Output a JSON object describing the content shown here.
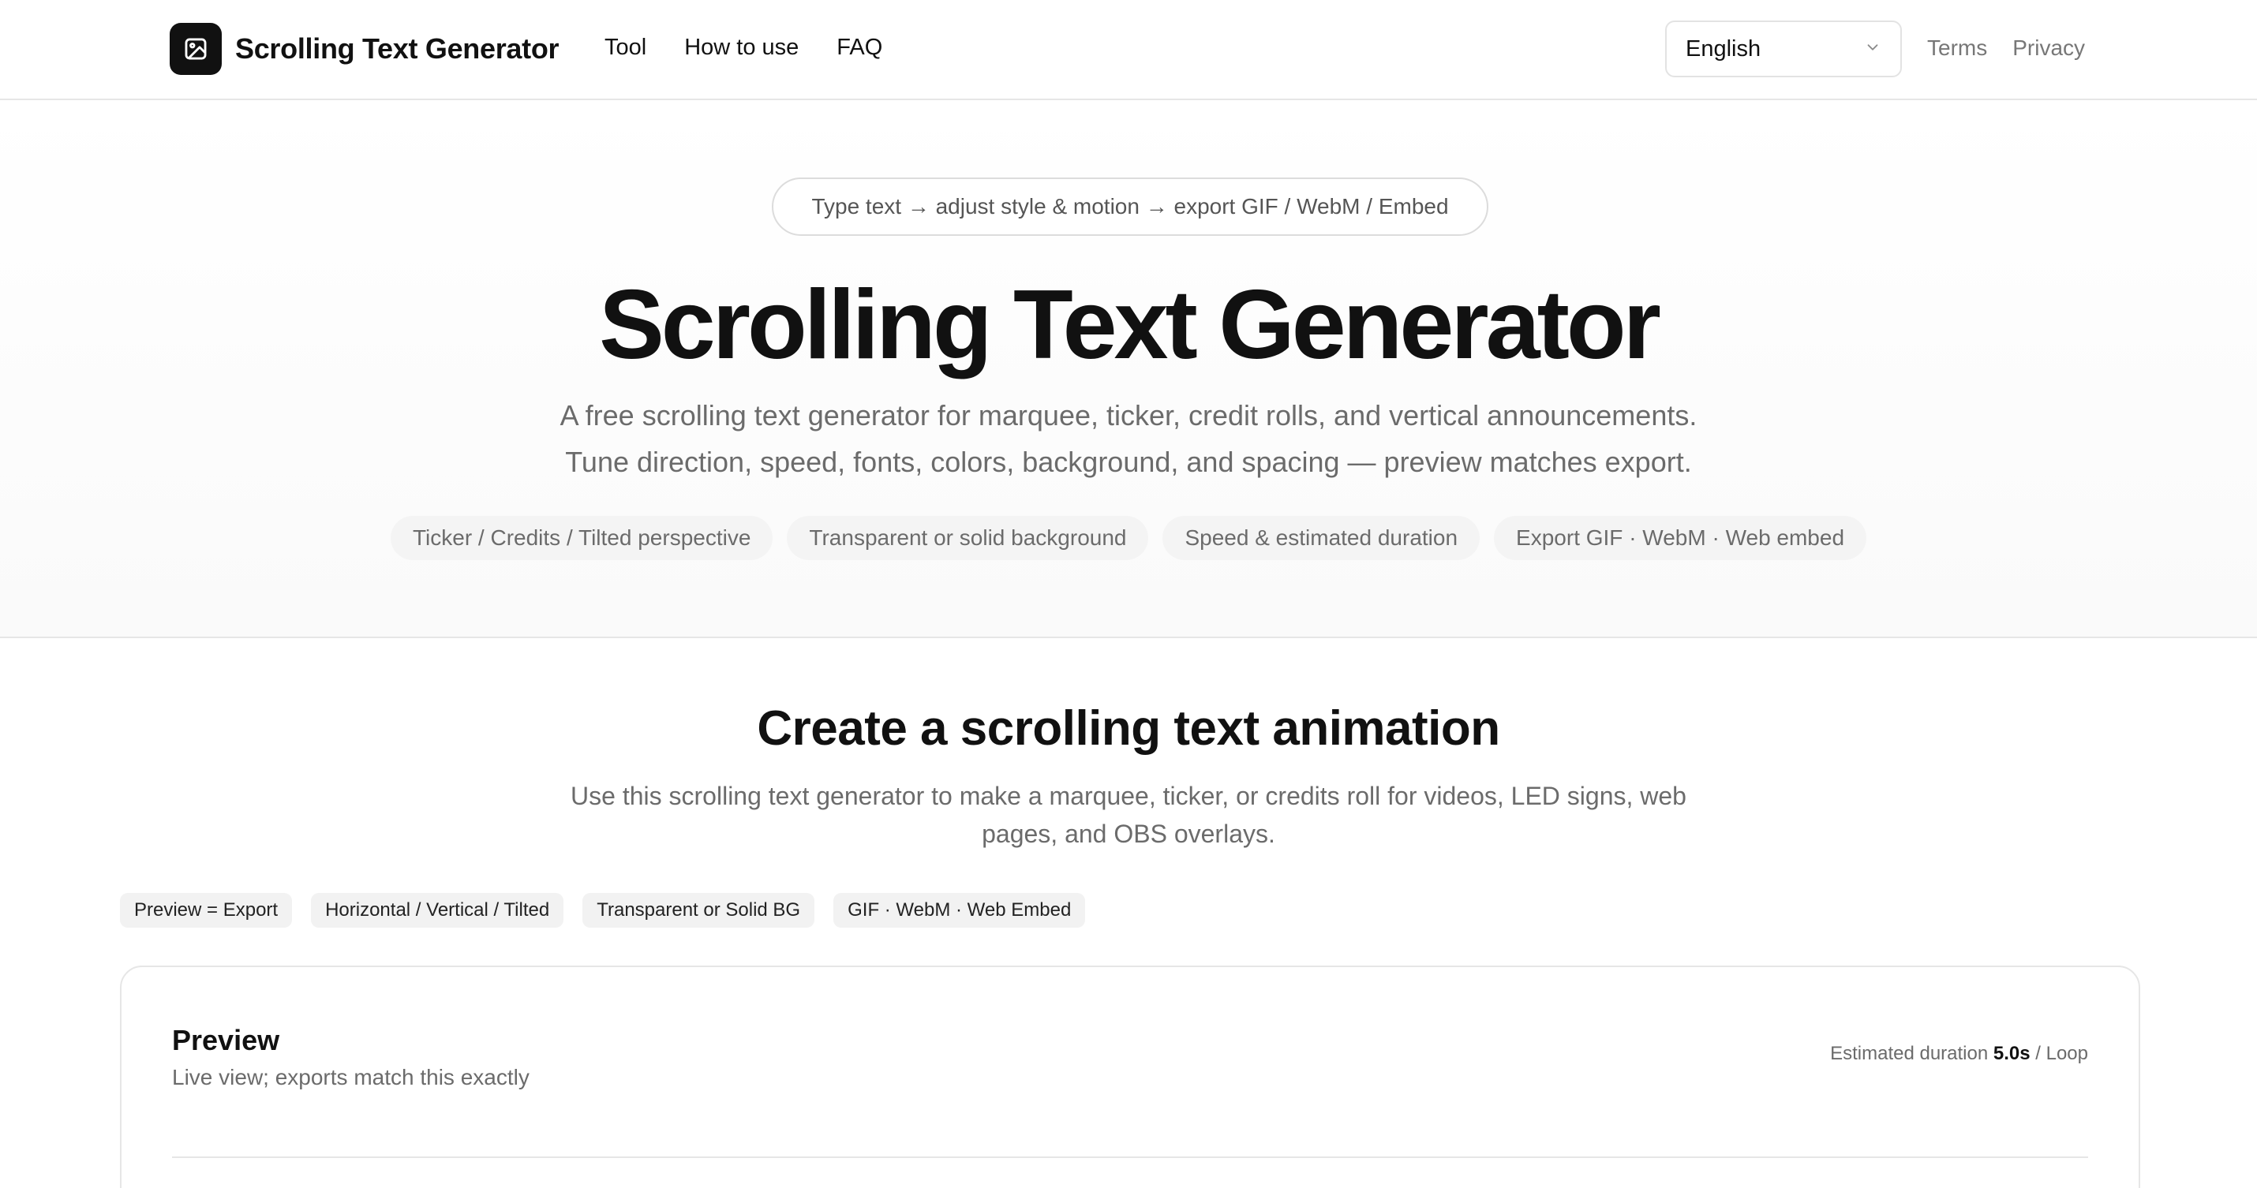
{
  "header": {
    "brand": "Scrolling Text Generator",
    "logo_icon": "image-icon",
    "nav": [
      "Tool",
      "How to use",
      "FAQ"
    ],
    "language": {
      "selected": "English",
      "icon": "chevron-down-icon"
    },
    "links": [
      "Terms",
      "Privacy"
    ]
  },
  "hero": {
    "pill": "Type text → adjust style & motion → export GIF / WebM / Embed",
    "title": "Scrolling Text Generator",
    "subtitle_lines": [
      "A free scrolling text generator for marquee, ticker, credit rolls, and vertical announcements.",
      "Tune direction, speed, fonts, colors, background, and spacing — preview matches export."
    ],
    "chips": [
      "Ticker / Credits / Tilted perspective",
      "Transparent or solid background",
      "Speed & estimated duration",
      "Export GIF · WebM · Web embed"
    ]
  },
  "section": {
    "title": "Create a scrolling text animation",
    "subtitle": "Use this scrolling text generator to make a marquee, ticker, or credits roll for videos, LED signs, web pages, and OBS overlays.",
    "tags": [
      "Preview = Export",
      "Horizontal / Vertical / Tilted",
      "Transparent or Solid BG",
      "GIF · WebM · Web Embed"
    ]
  },
  "preview": {
    "title": "Preview",
    "subtitle": "Live view; exports match this exactly",
    "duration_label": "Estimated duration",
    "duration_value": "5.0s",
    "loop_label": "/ Loop"
  }
}
